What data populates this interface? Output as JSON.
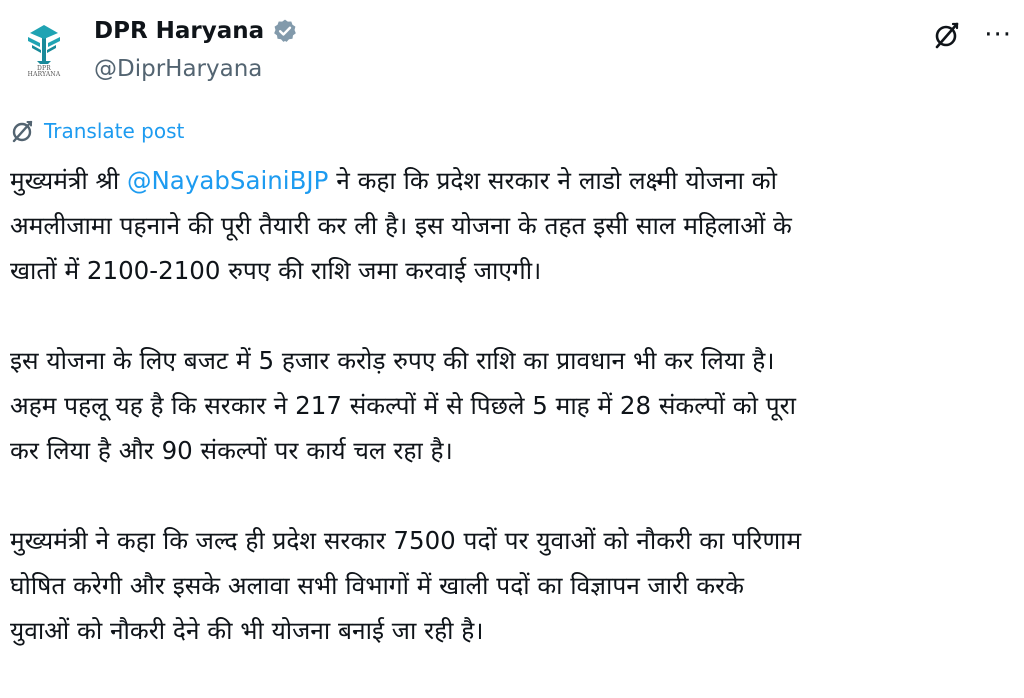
{
  "account": {
    "display_name": "DPR Haryana",
    "handle": "@DiprHaryana",
    "avatar_caption_line1": "DPR",
    "avatar_caption_line2": "HARYANA",
    "avatar_icon": "dpr-haryana-logo",
    "verified_icon": "verified-badge-icon",
    "verified_color": "#829aab"
  },
  "actions": {
    "grok_icon": "grok-icon",
    "more_label": "···"
  },
  "translate": {
    "icon": "translate-icon",
    "label": "Translate post",
    "color": "#1d9bf0"
  },
  "post": {
    "mention": "@NayabSainiBJP",
    "p1": {
      "line1_before": "मुख्यमंत्री श्री ",
      "line1_after": " ने कहा कि प्रदेश सरकार ने लाडो लक्ष्मी योजना को",
      "line2": "अमलीजामा पहनाने की पूरी तैयारी कर ली है। इस योजना के तहत इसी साल महिलाओं के",
      "line3": "खातों में 2100-2100 रुपए की राशि जमा करवाई जाएगी।"
    },
    "p2": {
      "line1": "इस योजना के लिए बजट में 5 हजार करोड़ रुपए की राशि का प्रावधान भी कर लिया है।",
      "line2": "अहम पहलू यह है कि सरकार ने 217 संकल्पों में से पिछले 5 माह में 28 संकल्पों को पूरा",
      "line3": "कर लिया है और 90 संकल्पों पर कार्य चल रहा है।"
    },
    "p3": {
      "line1": "मुख्यमंत्री ने कहा कि जल्द ही प्रदेश सरकार 7500 पदों पर युवाओं को नौकरी का परिणाम",
      "line2": "घोषित करेगी और इसके अलावा सभी विभागों में खाली पदों का विज्ञापन जारी करके",
      "line3": "युवाओं को नौकरी देने की भी योजना बनाई जा रही है।"
    }
  }
}
